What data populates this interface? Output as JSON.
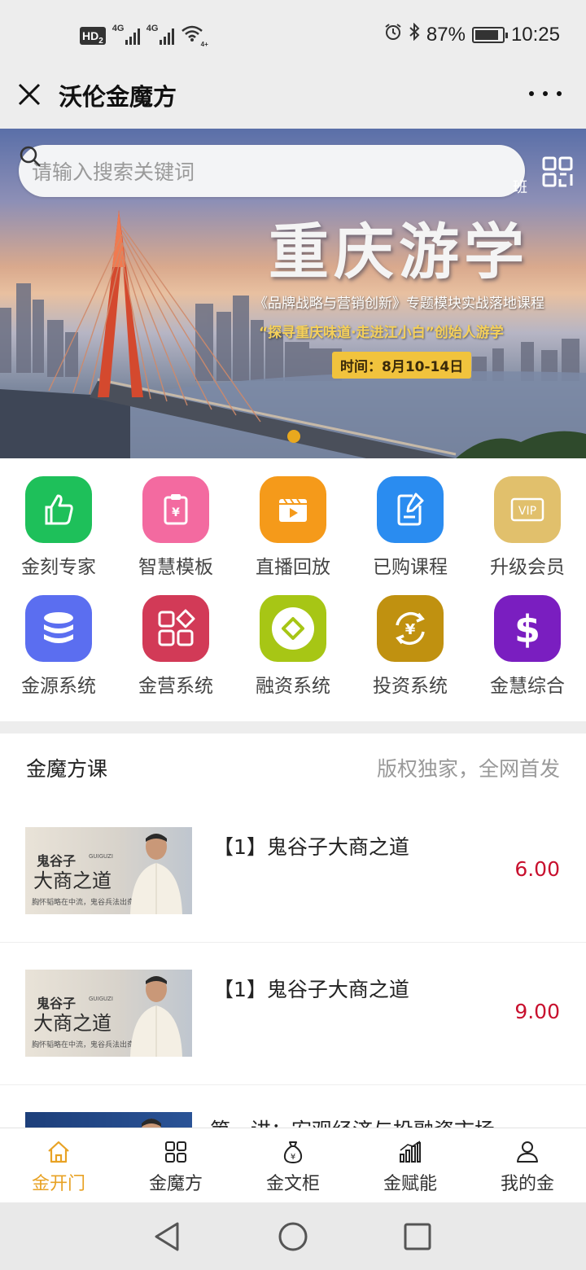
{
  "status_bar": {
    "hd": "HD",
    "hd_sub": "2",
    "net1": "4G",
    "net2": "4G",
    "wifi_sub": "4+",
    "battery_pct": "87%",
    "battery_level": 0.87,
    "time": "10:25"
  },
  "titlebar": {
    "title": "沃伦金魔方"
  },
  "banner": {
    "search_placeholder": "请输入搜索关键词",
    "headline": "重庆游学",
    "subline": "《品牌战略与营销创新》专题模块实战落地课程",
    "tagline": "“探寻重庆味道·走进江小白”创始人游学",
    "date": "时间：8月10-14日",
    "partial_text": "班"
  },
  "grid": [
    {
      "label": "金刻专家",
      "icon": "thumbs-up-icon",
      "color": "#1ec05a"
    },
    {
      "label": "智慧模板",
      "icon": "clipboard-yen-icon",
      "color": "#f36aa0"
    },
    {
      "label": "直播回放",
      "icon": "video-play-icon",
      "color": "#f59a1a"
    },
    {
      "label": "已购课程",
      "icon": "document-edit-icon",
      "color": "#2a8cf0"
    },
    {
      "label": "升级会员",
      "icon": "vip-card-icon",
      "color": "#e1c06c"
    },
    {
      "label": "金源系统",
      "icon": "database-icon",
      "color": "#5b6ef0"
    },
    {
      "label": "金营系统",
      "icon": "apps-grid-icon",
      "color": "#d23a57"
    },
    {
      "label": "融资系统",
      "icon": "diamond-icon",
      "color": "#a7c615"
    },
    {
      "label": "投资系统",
      "icon": "yen-cycle-icon",
      "color": "#c09110"
    },
    {
      "label": "金慧综合",
      "icon": "dollar-icon",
      "color": "#7a1ec0"
    }
  ],
  "courses_section": {
    "title": "金魔方课",
    "slogan": "版权独家，全网首发",
    "items": [
      {
        "title": "【1】鬼谷子大商之道",
        "price": "6.00",
        "thumb_small": "鬼谷子",
        "thumb_tag": "GUIGUZI",
        "thumb_big": "大商之道",
        "thumb_caption": "胸怀韬略在中流，鬼谷兵法出奇谋"
      },
      {
        "title": "【1】鬼谷子大商之道",
        "price": "9.00",
        "thumb_small": "鬼谷子",
        "thumb_tag": "GUIGUZI",
        "thumb_big": "大商之道",
        "thumb_caption": "胸怀韬略在中流，鬼谷兵法出奇谋"
      },
      {
        "title": "第一讲：宏观经济与投融资市场",
        "price": ""
      }
    ]
  },
  "bottom_nav": [
    {
      "label": "金开门",
      "icon": "home-icon",
      "active": true
    },
    {
      "label": "金魔方",
      "icon": "grid-icon",
      "active": false
    },
    {
      "label": "金文柜",
      "icon": "money-bag-icon",
      "active": false
    },
    {
      "label": "金赋能",
      "icon": "bar-chart-icon",
      "active": false
    },
    {
      "label": "我的金",
      "icon": "user-icon",
      "active": false
    }
  ],
  "colors": {
    "accent": "#e8a224",
    "price": "#c8102e"
  }
}
